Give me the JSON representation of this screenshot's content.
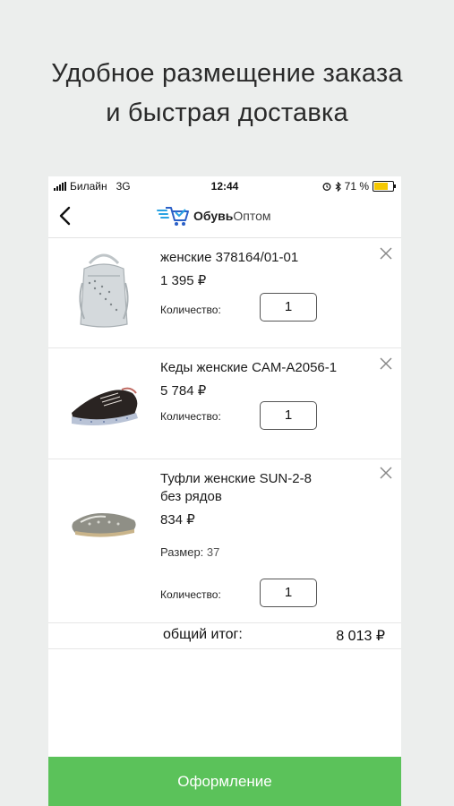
{
  "promo": {
    "line1": "Удобное размещение заказа",
    "line2": "и быстрая доставка"
  },
  "status_bar": {
    "carrier": "Билайн",
    "network": "3G",
    "time": "12:44",
    "battery": "71 %",
    "battery_level": 0.71
  },
  "header": {
    "back_icon": "chevron-left-icon",
    "logo_name": "ОбувьОптом",
    "logo_bold": "Обувь",
    "logo_regular": "Оптом"
  },
  "cart": {
    "qty_label": "Количество:",
    "items": [
      {
        "title_line1": "женские 378164/01-01",
        "price": "1 395 ₽",
        "quantity": "1",
        "image": "silver-backpack"
      },
      {
        "title_line1": "Кеды женские CAM-A2056-1",
        "price": "5 784 ₽",
        "quantity": "1",
        "image": "black-sneaker"
      },
      {
        "title_line1": "Туфли женские SUN-2-8",
        "title_line2": "без рядов",
        "price": "834 ₽",
        "size_label": "Размер:",
        "size_value": "37",
        "quantity": "1",
        "image": "silver-loafer"
      }
    ],
    "total_label": "общий итог:",
    "total_value": "8 013 ₽"
  },
  "checkout": {
    "label": "Оформление"
  },
  "colors": {
    "accent_green": "#5bc25a",
    "logo_blue": "#2aa3e3",
    "background": "#eceeed"
  }
}
